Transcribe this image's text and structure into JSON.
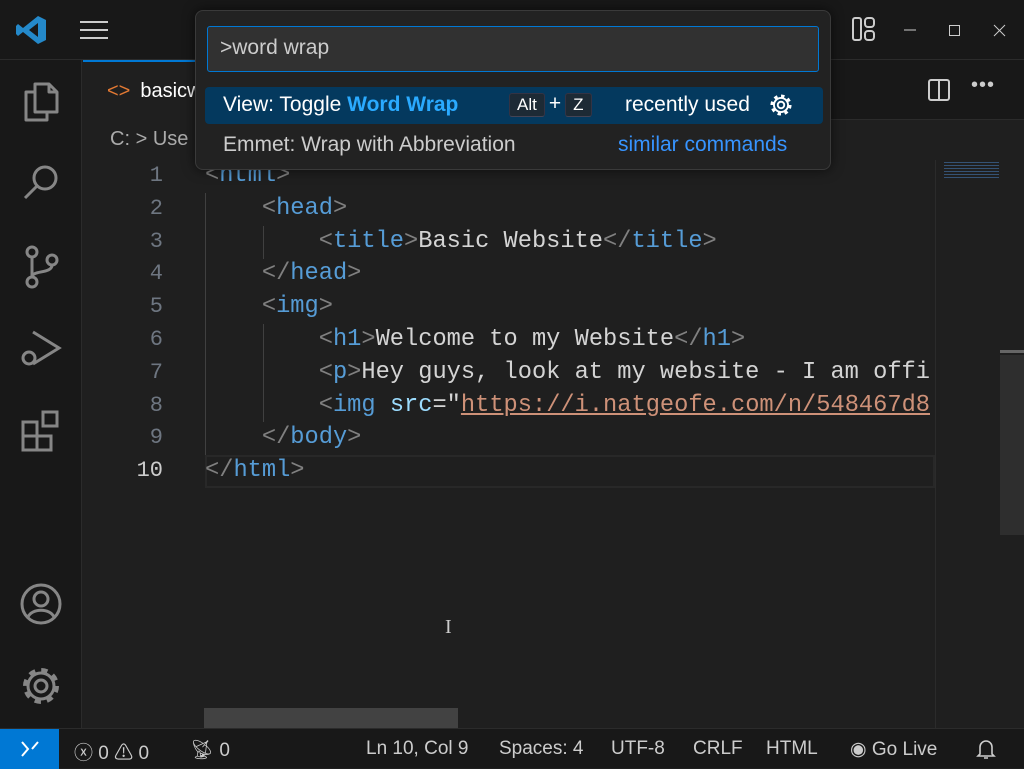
{
  "titlebar": {
    "icons": [
      "vscode-logo",
      "menu-icon",
      "layout-icon",
      "minimize-icon",
      "maximize-icon",
      "close-icon"
    ]
  },
  "activity": [
    "explorer-icon",
    "search-icon",
    "source-control-icon",
    "run-debug-icon",
    "extensions-icon",
    "account-icon",
    "settings-icon"
  ],
  "tab": {
    "label": "basicw"
  },
  "breadcrumb": {
    "drive": "C:",
    "sep": ">",
    "part": "Use"
  },
  "palette": {
    "input": ">word wrap",
    "items": [
      {
        "prefix": "View: Toggle ",
        "highlight": "Word Wrap",
        "key1": "Alt",
        "plus": "+",
        "key2": "Z",
        "note": "recently used"
      },
      {
        "label": "Emmet: Wrap with Abbreviation",
        "note": "similar commands"
      }
    ]
  },
  "editor": {
    "line_numbers": [
      "1",
      "2",
      "3",
      "4",
      "5",
      "6",
      "7",
      "8",
      "9",
      "10"
    ],
    "lines": [
      [
        [
          "p",
          "<"
        ],
        [
          "t",
          "html"
        ],
        [
          "p",
          ">"
        ]
      ],
      [
        [
          "x",
          "    "
        ],
        [
          "p",
          "<"
        ],
        [
          "t",
          "head"
        ],
        [
          "p",
          ">"
        ]
      ],
      [
        [
          "x",
          "        "
        ],
        [
          "p",
          "<"
        ],
        [
          "t",
          "title"
        ],
        [
          "p",
          ">"
        ],
        [
          "x",
          "Basic Website"
        ],
        [
          "p",
          "</"
        ],
        [
          "t",
          "title"
        ],
        [
          "p",
          ">"
        ]
      ],
      [
        [
          "x",
          "    "
        ],
        [
          "p",
          "</"
        ],
        [
          "t",
          "head"
        ],
        [
          "p",
          ">"
        ]
      ],
      [
        [
          "x",
          "    "
        ],
        [
          "p",
          "<"
        ],
        [
          "t",
          "img"
        ],
        [
          "p",
          ">"
        ]
      ],
      [
        [
          "x",
          "        "
        ],
        [
          "p",
          "<"
        ],
        [
          "t",
          "h1"
        ],
        [
          "p",
          ">"
        ],
        [
          "x",
          "Welcome to my Website"
        ],
        [
          "p",
          "</"
        ],
        [
          "t",
          "h1"
        ],
        [
          "p",
          ">"
        ]
      ],
      [
        [
          "x",
          "        "
        ],
        [
          "p",
          "<"
        ],
        [
          "t",
          "p"
        ],
        [
          "p",
          ">"
        ],
        [
          "x",
          "Hey guys, look at my website - I am offi"
        ]
      ],
      [
        [
          "x",
          "        "
        ],
        [
          "p",
          "<"
        ],
        [
          "t",
          "img"
        ],
        [
          "x",
          " "
        ],
        [
          "a",
          "src"
        ],
        [
          "x",
          "=\""
        ],
        [
          "s",
          "https://i.natgeofe.com/n/548467d8"
        ]
      ],
      [
        [
          "x",
          "    "
        ],
        [
          "p",
          "</"
        ],
        [
          "t",
          "body"
        ],
        [
          "p",
          ">"
        ]
      ],
      [
        [
          "p",
          "</"
        ],
        [
          "t",
          "html"
        ],
        [
          "p",
          ">"
        ]
      ]
    ]
  },
  "status": {
    "remote": "><",
    "errors": "0",
    "warnings": "0",
    "ports": "0",
    "position": "Ln 10, Col 9",
    "spaces": "Spaces: 4",
    "encoding": "UTF-8",
    "eol": "CRLF",
    "language": "HTML",
    "golive": "Go Live"
  }
}
